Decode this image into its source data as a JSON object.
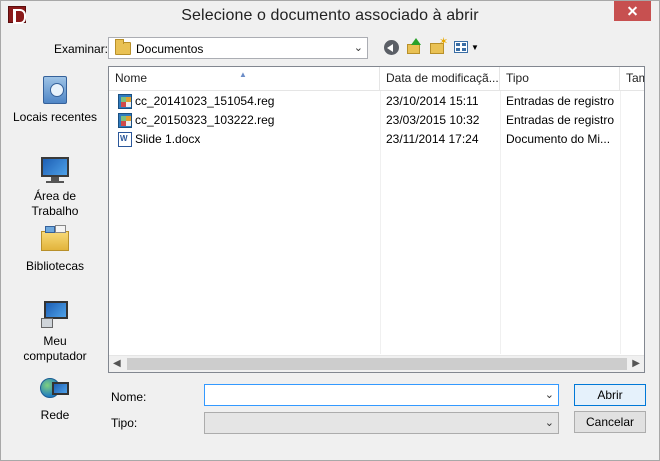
{
  "window": {
    "title": "Selecione o documento associado à abrir"
  },
  "toolbar": {
    "look_in_label": "Examinar:",
    "look_in_value": "Documentos",
    "icons": [
      "back-icon",
      "up-folder-icon",
      "new-folder-icon",
      "view-menu-icon"
    ]
  },
  "places": [
    {
      "label": "Locais recentes",
      "icon": "recent-places-icon"
    },
    {
      "label": "Área de Trabalho",
      "icon": "desktop-icon"
    },
    {
      "label": "Bibliotecas",
      "icon": "libraries-icon"
    },
    {
      "label": "Meu computador",
      "icon": "computer-icon"
    },
    {
      "label": "Rede",
      "icon": "network-icon"
    }
  ],
  "filelist": {
    "columns": [
      "Nome",
      "Data de modificaçã...",
      "Tipo",
      "Tam"
    ],
    "rows": [
      {
        "name": "cc_20141023_151054.reg",
        "date": "23/10/2014 15:11",
        "type": "Entradas de registro",
        "icon": "reg-file-icon"
      },
      {
        "name": "cc_20150323_103222.reg",
        "date": "23/03/2015 10:32",
        "type": "Entradas de registro",
        "icon": "reg-file-icon"
      },
      {
        "name": "Slide 1.docx",
        "date": "23/11/2014 17:24",
        "type": "Documento do Mi...",
        "icon": "word-document-icon"
      }
    ]
  },
  "form": {
    "name_label": "Nome:",
    "name_value": "",
    "type_label": "Tipo:",
    "type_value": ""
  },
  "buttons": {
    "open": "Abrir",
    "cancel": "Cancelar"
  },
  "colors": {
    "close_button": "#c75050",
    "focus_border": "#3399ff",
    "default_button_border": "#0078d7"
  }
}
